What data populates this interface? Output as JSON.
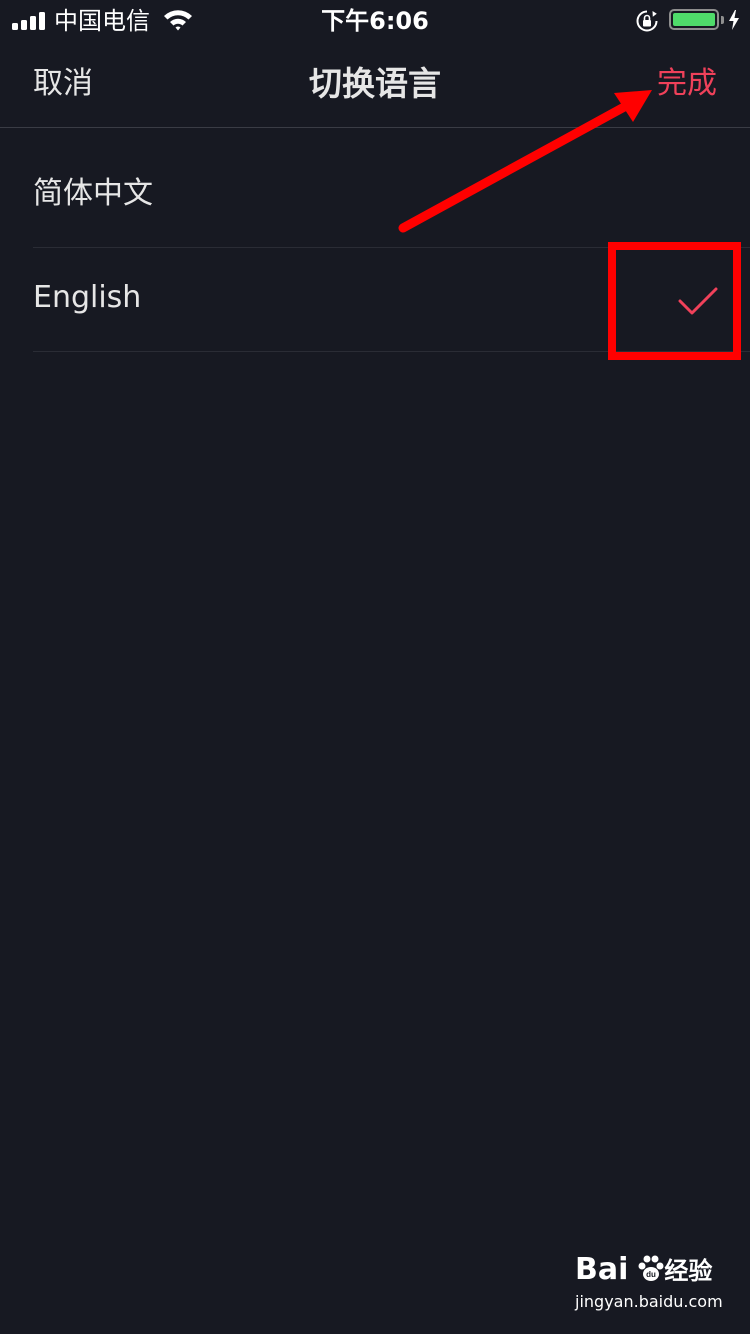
{
  "status_bar": {
    "carrier": "中国电信",
    "time": "下午6:06",
    "battery_level": 1.0,
    "icons": [
      "signal-icon",
      "wifi-icon",
      "orientation-lock-icon",
      "battery-icon",
      "charging-icon"
    ]
  },
  "nav": {
    "cancel_label": "取消",
    "title": "切换语言",
    "done_label": "完成"
  },
  "languages": [
    {
      "label": "简体中文",
      "selected": false
    },
    {
      "label": "English",
      "selected": true
    }
  ],
  "annotation": {
    "color": "#ff0000",
    "shapes": [
      "arrow-to-done",
      "box-around-checkmark"
    ]
  },
  "watermark": {
    "logo_text": "Bai",
    "logo_text_tail": "经验",
    "site": "jingyan.baidu.com"
  },
  "colors": {
    "background": "#171922",
    "accent": "#f0415a",
    "text": "#e6e6e6"
  }
}
